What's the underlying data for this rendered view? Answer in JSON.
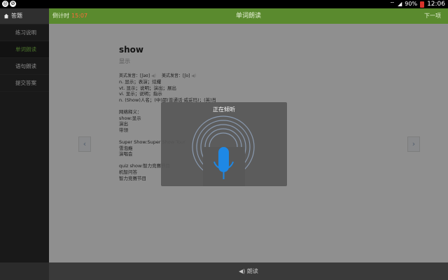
{
  "status_bar": {
    "battery": "90%",
    "time": "12:06"
  },
  "sidebar": {
    "header": "答题",
    "items": [
      {
        "label": "练习说明"
      },
      {
        "label": "单词朗读"
      },
      {
        "label": "语句朗读"
      },
      {
        "label": "提交答案"
      }
    ]
  },
  "topbar": {
    "timer_label": "倒计时",
    "timer_value": "15:07",
    "title": "单词朗读",
    "next_label": "下一项"
  },
  "word_card": {
    "word": "show",
    "meaning": "显示",
    "phonetic_uk": "英式发音：[ʃəʊ]",
    "phonetic_us": "美式发音：[ʃo]",
    "definitions": [
      "n. 显示；表演；炫耀",
      "vt. 显示；说明；演出；展出",
      "vi. 显示；说明；指示",
      "n. (Show)人名；(中)邵(普通话·威妥玛)；(英)肖",
      "",
      "网络释义：",
      "show:显示",
      "演出",
      "带领",
      "",
      "Super Show:Super Show Tour",
      "雪泡瘾",
      "演唱会",
      "",
      "quiz show:智力竞赛节目",
      "机智问答",
      "智力竞赛节目"
    ]
  },
  "dialog": {
    "title": "正在倾听"
  },
  "bottom_bar": {
    "read_label": "朗读"
  },
  "colors": {
    "accent_green": "#5a8a2e",
    "active_green": "#7fc24a",
    "mic_blue": "#1e88e5"
  }
}
